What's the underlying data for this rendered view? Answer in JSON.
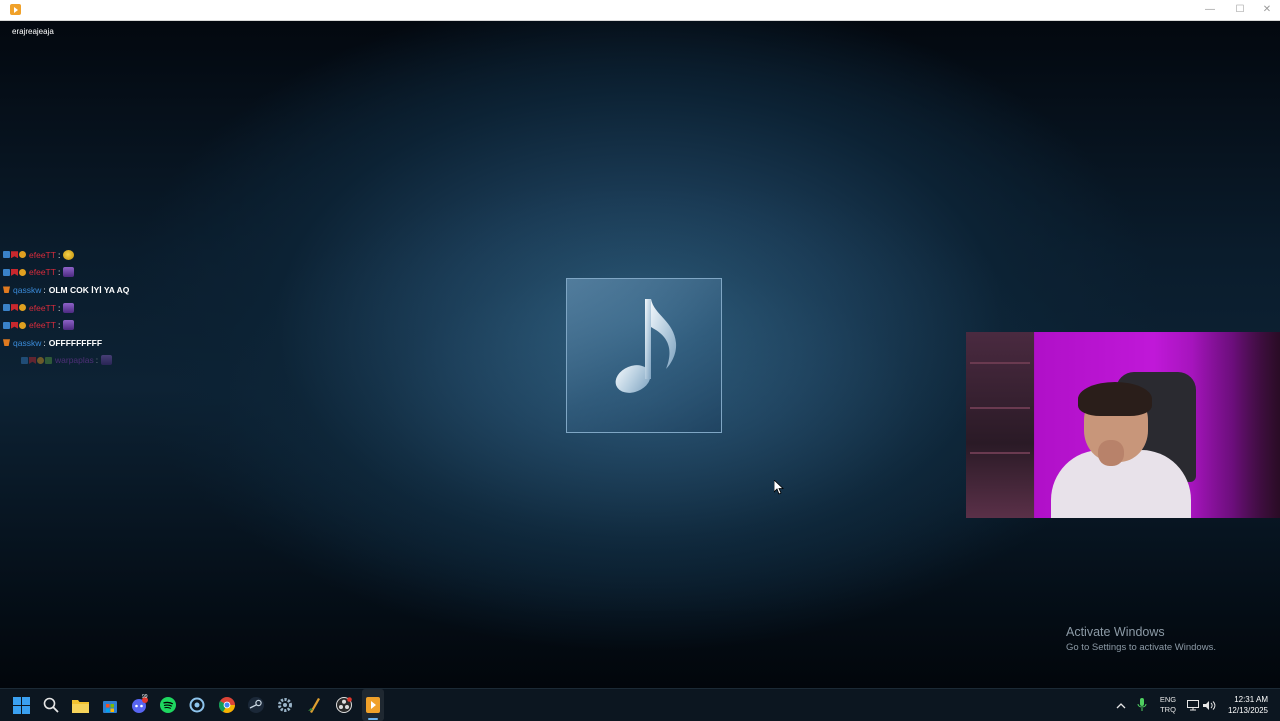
{
  "window": {
    "title_bar_buttons": {
      "minimize": "—",
      "maximize": "☐",
      "close": "✕"
    }
  },
  "overlay": {
    "window_label": "erajreajeaja"
  },
  "chat": {
    "messages": [
      {
        "user": "efeeTT",
        "text": "",
        "emote": "yellow",
        "user_color": "#d82c3c",
        "badges": [
          "blue",
          "red",
          "gold"
        ],
        "faded": false
      },
      {
        "user": "efeeTT",
        "text": "",
        "emote": "purple",
        "user_color": "#d82c3c",
        "badges": [
          "blue",
          "red",
          "gold"
        ],
        "faded": false
      },
      {
        "user": "qasskw",
        "text": "OLM COK İYİ YA AQ",
        "emote": "",
        "user_color": "#3a8ad8",
        "badges": [
          "orange"
        ],
        "faded": false
      },
      {
        "user": "efeeTT",
        "text": "",
        "emote": "purple",
        "user_color": "#d82c3c",
        "badges": [
          "blue",
          "red",
          "gold"
        ],
        "faded": false
      },
      {
        "user": "efeeTT",
        "text": "",
        "emote": "purple",
        "user_color": "#d82c3c",
        "badges": [
          "blue",
          "red",
          "gold"
        ],
        "faded": false
      },
      {
        "user": "qasskw",
        "text": "OFFFFFFFFF",
        "emote": "",
        "user_color": "#3a8ad8",
        "badges": [
          "orange"
        ],
        "faded": false
      },
      {
        "user": "warpaplas",
        "text": "",
        "emote": "purple",
        "user_color": "#9a40c8",
        "badges": [
          "blue",
          "red",
          "gold",
          "green"
        ],
        "faded": true
      }
    ]
  },
  "media": {
    "tile_icon": "music-note-icon"
  },
  "watermark": {
    "title": "Activate Windows",
    "subtitle": "Go to Settings to activate Windows."
  },
  "taskbar": {
    "icons": [
      "windows-start-icon",
      "search-icon",
      "file-explorer-icon",
      "store-icon",
      "discord-icon",
      "spotify-icon",
      "network-tool-icon",
      "chrome-icon",
      "steam-icon",
      "settings-icon",
      "pen-app-icon",
      "obs-icon",
      "media-player-icon"
    ],
    "discord_badge": "99",
    "tray": {
      "language_line1": "ENG",
      "language_line2": "TRQ",
      "time": "12:31 AM",
      "date": "12/13/2025"
    }
  },
  "colors": {
    "accent": "#6cb4f0",
    "webcam_backlight": "#c018d8",
    "taskbar_bg": "#0c1620"
  }
}
